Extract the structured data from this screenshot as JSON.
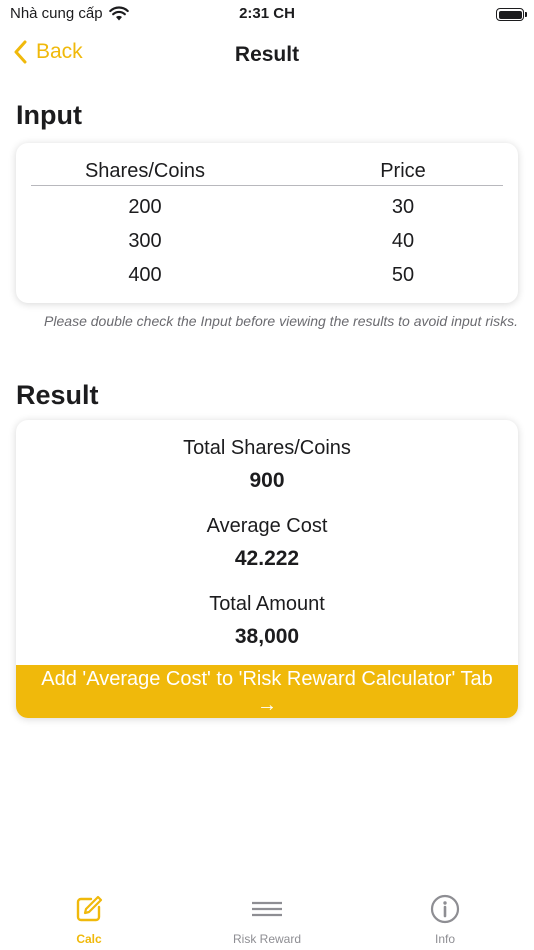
{
  "status_bar": {
    "carrier": "Nhà cung cấp",
    "time": "2:31 CH"
  },
  "nav": {
    "back_label": "Back",
    "title": "Result"
  },
  "input_section": {
    "title": "Input",
    "columns": [
      "Shares/Coins",
      "Price"
    ],
    "rows": [
      [
        "200",
        "30"
      ],
      [
        "300",
        "40"
      ],
      [
        "400",
        "50"
      ]
    ],
    "note": "Please double check the Input before viewing the results to avoid input risks."
  },
  "result_section": {
    "title": "Result",
    "total_shares_label": "Total Shares/Coins",
    "total_shares_value": "900",
    "average_cost_label": "Average Cost",
    "average_cost_value": "42.222",
    "total_amount_label": "Total Amount",
    "total_amount_value": "38,000",
    "add_button_label": "Add 'Average Cost' to 'Risk Reward Calculator' Tab",
    "add_button_arrow": "→"
  },
  "tabs": [
    {
      "label": "Calc",
      "icon": "edit-icon",
      "active": true
    },
    {
      "label": "Risk Reward",
      "icon": "menu-lines-icon",
      "active": false
    },
    {
      "label": "Info",
      "icon": "info-icon",
      "active": false
    }
  ],
  "colors": {
    "accent": "#f0b90b",
    "text": "#1c1c1e",
    "muted": "#8e8e93"
  }
}
